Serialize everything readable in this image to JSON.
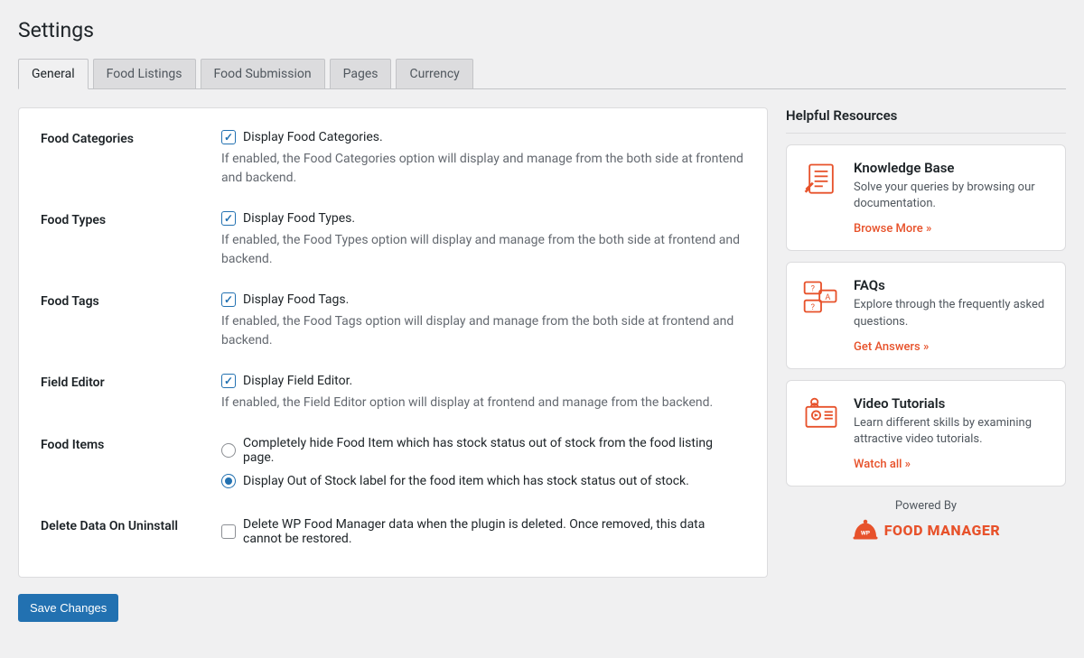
{
  "page_title": "Settings",
  "tabs": [
    {
      "label": "General",
      "active": true
    },
    {
      "label": "Food Listings",
      "active": false
    },
    {
      "label": "Food Submission",
      "active": false
    },
    {
      "label": "Pages",
      "active": false
    },
    {
      "label": "Currency",
      "active": false
    }
  ],
  "settings": {
    "food_categories": {
      "label": "Food Categories",
      "checkbox_label": "Display Food Categories.",
      "checked": true,
      "help": "If enabled, the Food Categories option will display and manage from the both side at frontend and backend."
    },
    "food_types": {
      "label": "Food Types",
      "checkbox_label": "Display Food Types.",
      "checked": true,
      "help": "If enabled, the Food Types option will display and manage from the both side at frontend and backend."
    },
    "food_tags": {
      "label": "Food Tags",
      "checkbox_label": "Display Food Tags.",
      "checked": true,
      "help": "If enabled, the Food Tags option will display and manage from the both side at frontend and backend."
    },
    "field_editor": {
      "label": "Field Editor",
      "checkbox_label": "Display Field Editor.",
      "checked": true,
      "help": "If enabled, the Field Editor option will display at frontend and manage from the backend."
    },
    "food_items": {
      "label": "Food Items",
      "options": [
        {
          "label": "Completely hide Food Item which has stock status out of stock from the food listing page.",
          "selected": false
        },
        {
          "label": "Display Out of Stock label for the food item which has stock status out of stock.",
          "selected": true
        }
      ]
    },
    "delete_data": {
      "label": "Delete Data On Uninstall",
      "checkbox_label": "Delete WP Food Manager data when the plugin is deleted. Once removed, this data cannot be restored.",
      "checked": false
    }
  },
  "save_button": "Save Changes",
  "sidebar": {
    "title": "Helpful Resources",
    "resources": [
      {
        "title": "Knowledge Base",
        "desc": "Solve your queries by browsing our documentation.",
        "link": "Browse More »"
      },
      {
        "title": "FAQs",
        "desc": "Explore through the frequently asked questions.",
        "link": "Get Answers »"
      },
      {
        "title": "Video Tutorials",
        "desc": "Learn different skills by examining attractive video tutorials.",
        "link": "Watch all »"
      }
    ],
    "powered_by": "Powered By",
    "brand": "FOOD MANAGER",
    "brand_badge": "WP"
  },
  "colors": {
    "accent": "#e7522b",
    "primary_button": "#2271b1"
  }
}
